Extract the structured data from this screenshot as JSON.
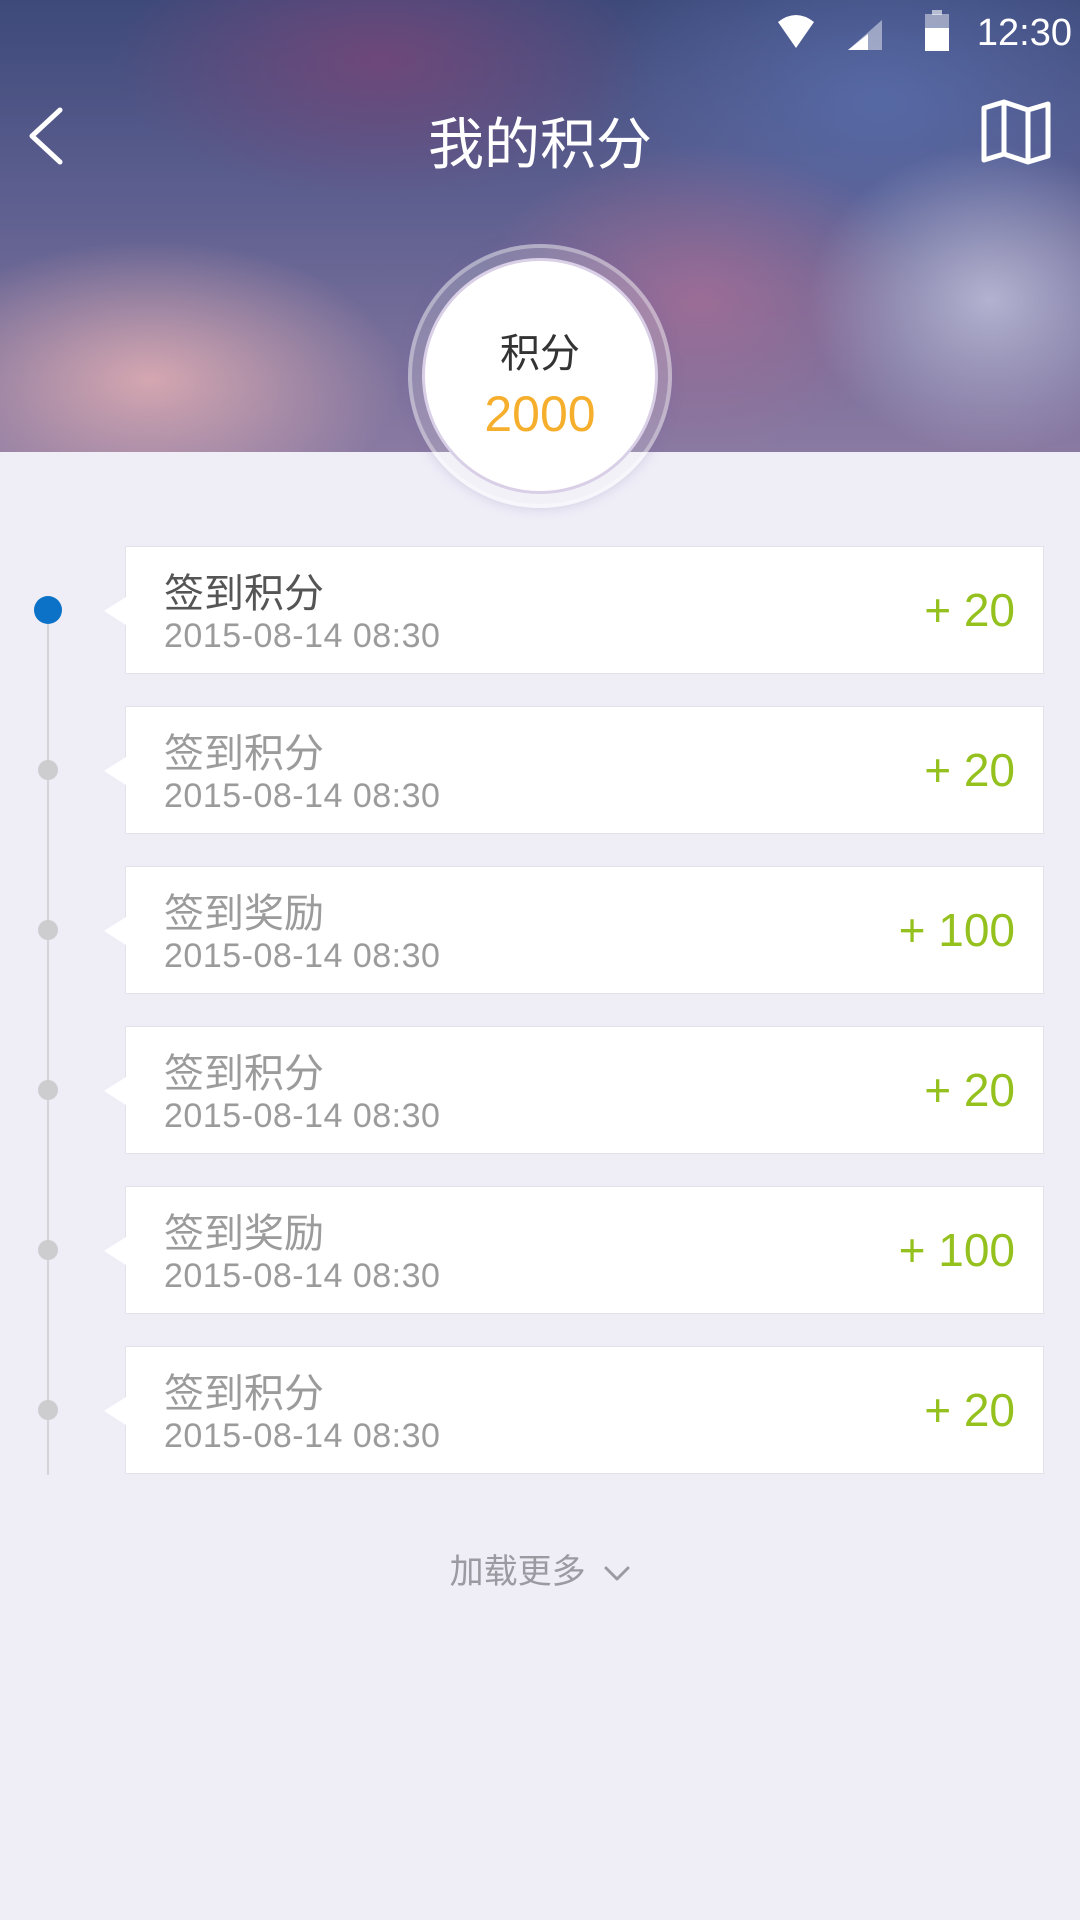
{
  "status_bar": {
    "time": "12:30",
    "icons": [
      "wifi-icon",
      "signal-icon",
      "battery-icon"
    ]
  },
  "header": {
    "title": "我的积分",
    "back_icon": "chevron-left-icon",
    "action_icon": "map-icon"
  },
  "score": {
    "label": "积分",
    "value": "2000",
    "value_color": "#f6ae2d"
  },
  "records": [
    {
      "title": "签到积分",
      "time": "2015-08-14  08:30",
      "points": "+ 20"
    },
    {
      "title": "签到积分",
      "time": "2015-08-14  08:30",
      "points": "+ 20"
    },
    {
      "title": "签到奖励",
      "time": "2015-08-14  08:30",
      "points": "+ 100"
    },
    {
      "title": "签到积分",
      "time": "2015-08-14  08:30",
      "points": "+ 20"
    },
    {
      "title": "签到奖励",
      "time": "2015-08-14  08:30",
      "points": "+ 100"
    },
    {
      "title": "签到积分",
      "time": "2015-08-14  08:30",
      "points": "+ 20"
    }
  ],
  "load_more": {
    "label": "加载更多",
    "icon": "chevron-down-icon"
  },
  "colors": {
    "accent_blue": "#0b72c7",
    "points_green": "#95c11f",
    "background": "#efeef7"
  }
}
